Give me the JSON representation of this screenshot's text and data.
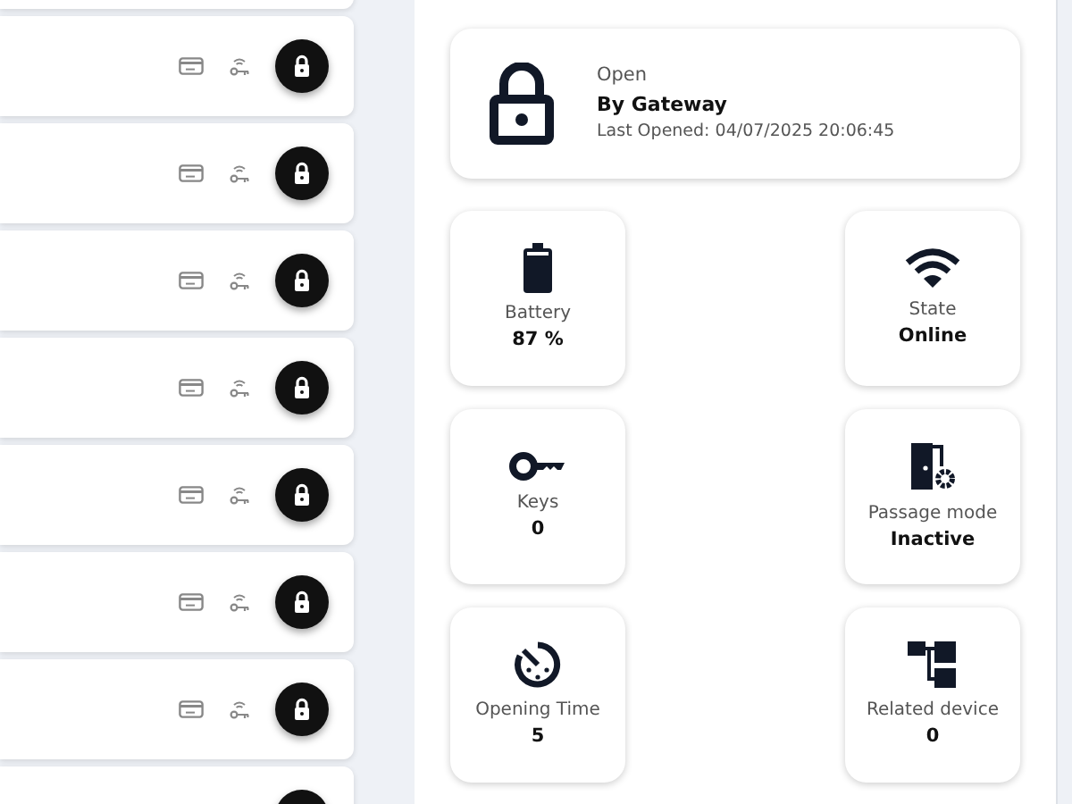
{
  "lock_list": [
    {
      "locked": true
    },
    {
      "locked": true
    },
    {
      "locked": true
    },
    {
      "locked": true
    },
    {
      "locked": true
    },
    {
      "locked": true
    },
    {
      "locked": true
    },
    {
      "locked": true
    }
  ],
  "status": {
    "label": "Open",
    "by": "By Gateway",
    "last_opened": "Last Opened: 04/07/2025 20:06:45"
  },
  "tiles": [
    {
      "kind": "battery",
      "label": "Battery",
      "value": "87 %"
    },
    {
      "kind": "wifi",
      "label": "State",
      "value": "Online"
    },
    {
      "kind": "key",
      "label": "Keys",
      "value": "0"
    },
    {
      "kind": "passage",
      "label": "Passage mode",
      "value": "Inactive"
    },
    {
      "kind": "timer",
      "label": "Opening Time",
      "value": "5"
    },
    {
      "kind": "relation",
      "label": "Related device",
      "value": "0"
    }
  ]
}
